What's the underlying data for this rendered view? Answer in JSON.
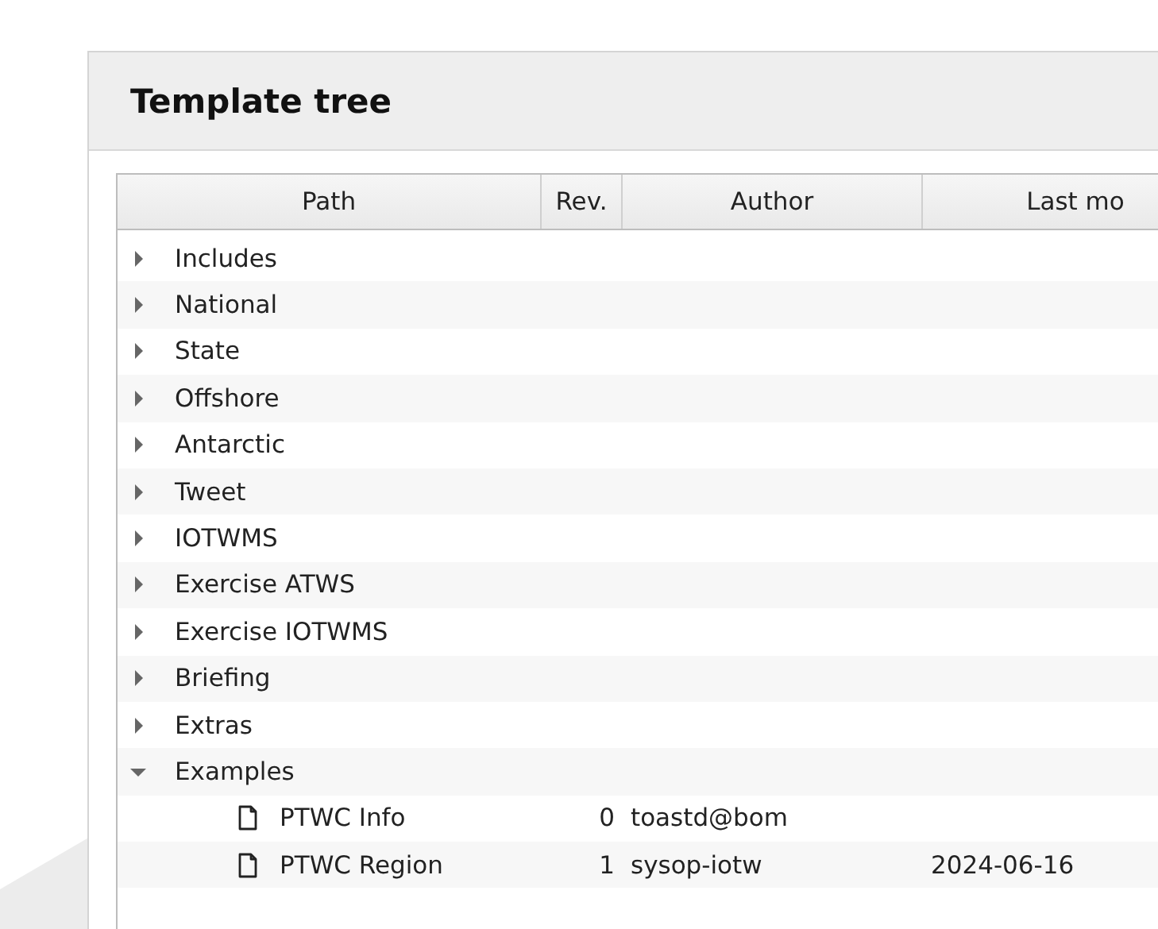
{
  "panel": {
    "title": "Template tree"
  },
  "table": {
    "columns": [
      "Path",
      "Rev.",
      "Author",
      "Last mo"
    ],
    "rows": [
      {
        "label": "Includes",
        "kind": "folder",
        "expanded": false
      },
      {
        "label": "National",
        "kind": "folder",
        "expanded": false
      },
      {
        "label": "State",
        "kind": "folder",
        "expanded": false
      },
      {
        "label": "Offshore",
        "kind": "folder",
        "expanded": false
      },
      {
        "label": "Antarctic",
        "kind": "folder",
        "expanded": false
      },
      {
        "label": "Tweet",
        "kind": "folder",
        "expanded": false
      },
      {
        "label": "IOTWMS",
        "kind": "folder",
        "expanded": false
      },
      {
        "label": "Exercise ATWS",
        "kind": "folder",
        "expanded": false
      },
      {
        "label": "Exercise IOTWMS",
        "kind": "folder",
        "expanded": false
      },
      {
        "label": "Briefing",
        "kind": "folder",
        "expanded": false
      },
      {
        "label": "Extras",
        "kind": "folder",
        "expanded": false
      },
      {
        "label": "Examples",
        "kind": "folder",
        "expanded": true,
        "children": [
          {
            "label": "PTWC Info",
            "kind": "file",
            "cells": [
              "0",
              "toastd@bom"
            ]
          },
          {
            "label": "PTWC Region",
            "kind": "file",
            "cells": [
              "1",
              "sysop-iotw",
              "2024-06-16"
            ]
          }
        ]
      }
    ]
  }
}
